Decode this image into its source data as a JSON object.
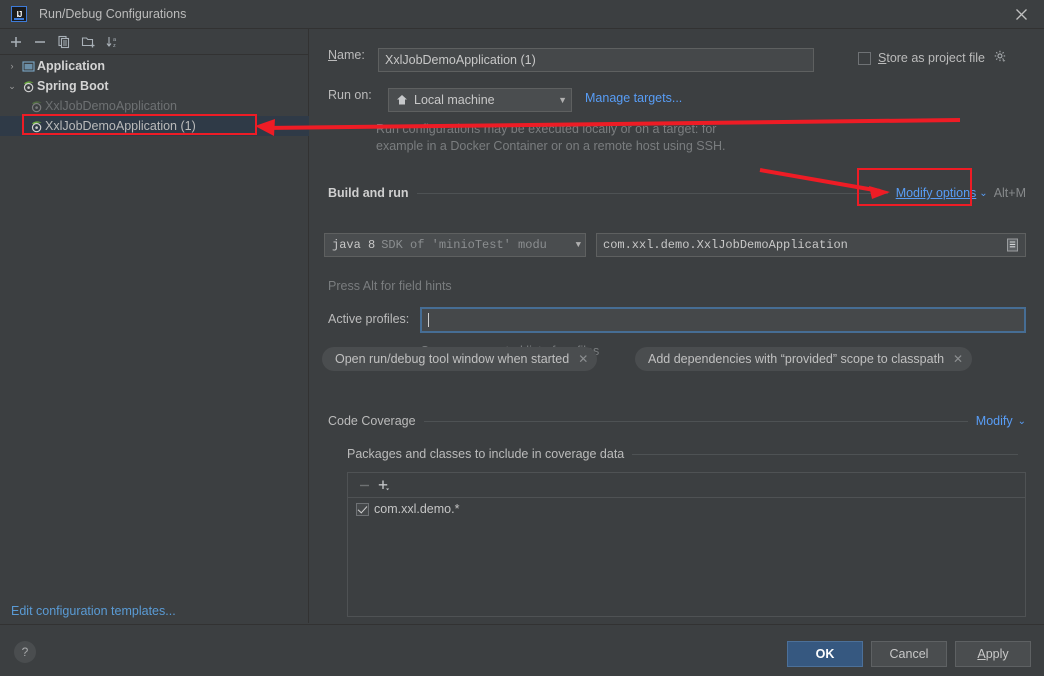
{
  "window": {
    "title": "Run/Debug Configurations",
    "logo_icon": "intellij-idea-logo-icon",
    "close_icon": "close-icon"
  },
  "sidebar": {
    "toolbar": [
      {
        "name": "add-configuration-button",
        "icon": "plus-icon",
        "label": "+"
      },
      {
        "name": "remove-configuration-button",
        "icon": "minus-icon",
        "label": "−"
      },
      {
        "name": "copy-configuration-button",
        "icon": "copy-icon",
        "label": ""
      },
      {
        "name": "save-configuration-button",
        "icon": "folder-add-icon",
        "label": ""
      },
      {
        "name": "sort-configurations-button",
        "icon": "sort-alphabetically-icon",
        "label": ""
      }
    ],
    "tree": [
      {
        "label": "Application",
        "icon": "application-icon",
        "twisty": "›",
        "level": 1,
        "bold": true,
        "dim": false,
        "selected": false
      },
      {
        "label": "Spring Boot",
        "icon": "spring-boot-icon",
        "twisty": "⌄",
        "level": 1,
        "bold": true,
        "dim": false,
        "selected": false
      },
      {
        "label": "XxlJobDemoApplication",
        "icon": "spring-boot-icon",
        "twisty": "",
        "level": 2,
        "bold": false,
        "dim": true,
        "selected": false
      },
      {
        "label": "XxlJobDemoApplication (1)",
        "icon": "spring-boot-icon",
        "twisty": "",
        "level": 2,
        "bold": false,
        "dim": false,
        "selected": true
      }
    ],
    "edit_templates_link": "Edit configuration templates..."
  },
  "form": {
    "name_label": "Name:",
    "name_mnemonic": "N",
    "name_value": "XxlJobDemoApplication (1)",
    "store_as_project_file_label": "Store as project file",
    "store_as_project_file_mnemonic": "S",
    "store_as_project_file_checked": false,
    "store_gear_icon": "gear-icon",
    "run_on_label": "Run on:",
    "run_on_value": "Local machine",
    "run_on_icon": "local-machine-icon",
    "manage_targets_link": "Manage targets...",
    "run_on_hint_line1": "Run configurations may be executed locally or on a target: for",
    "run_on_hint_line2": "example in a Docker Container or on a remote host using SSH.",
    "build_and_run_title": "Build and run",
    "modify_options_link": "Modify options",
    "modify_options_chevron": "⌄",
    "modify_options_shortcut": "Alt+M",
    "jdk_value_primary": "java 8",
    "jdk_value_secondary": "SDK of 'minioTest' modu",
    "main_class_value": "com.xxl.demo.XxlJobDemoApplication",
    "main_class_browse_icon": "class-browse-icon",
    "field_hints_text": "Press Alt for field hints",
    "active_profiles_label": "Active profiles:",
    "active_profiles_value": "",
    "active_profiles_hint": "Comma separated list of profiles",
    "chips": [
      {
        "label": "Open run/debug tool window when started",
        "close_icon": "close-chip-icon"
      },
      {
        "label": "Add dependencies with “provided” scope to classpath",
        "close_icon": "close-chip-icon"
      }
    ],
    "code_coverage_title": "Code Coverage",
    "code_coverage_modify_link": "Modify",
    "code_coverage_modify_chevron": "⌄",
    "packages_title": "Packages and classes to include in coverage data",
    "coverage_toolbar": [
      {
        "name": "remove-package-button",
        "icon": "minus-icon"
      },
      {
        "name": "add-package-button",
        "icon": "plus-dropdown-icon"
      }
    ],
    "coverage_items": [
      {
        "label": "com.xxl.demo.*",
        "checked": true
      }
    ]
  },
  "footer": {
    "help_label": "?",
    "ok_label": "OK",
    "cancel_label": "Cancel",
    "apply_label": "Apply",
    "apply_mnemonic": "A"
  },
  "annotation": {
    "color": "#ee1c25",
    "highlight_target": "modify-options-link",
    "source_target": "tree-row-selected"
  }
}
